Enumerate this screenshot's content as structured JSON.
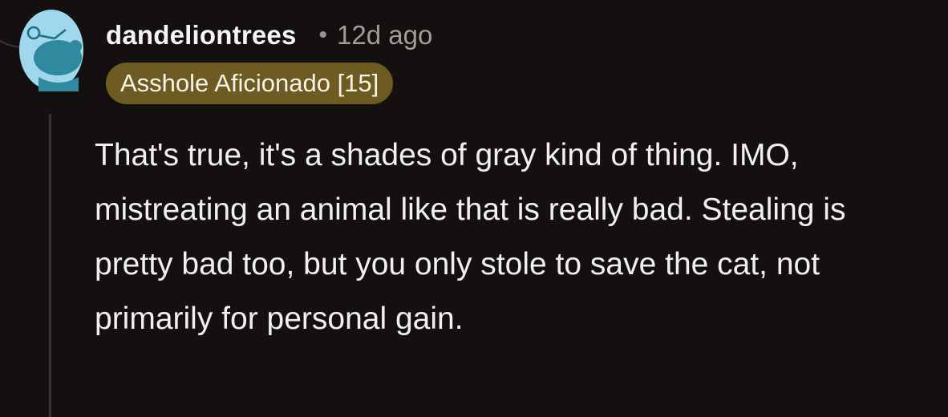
{
  "comment": {
    "author": "dandeliontrees",
    "separator": "•",
    "age": "12d ago",
    "flair": "Asshole Aficionado [15]",
    "colors": {
      "background": "#141010",
      "flair_background": "#6d5b22",
      "avatar_background": "#9fd8ec",
      "avatar_figure": "#2f8aa0"
    },
    "avatar_icon": "snoo-avatar-icon",
    "body": "That's true, it's a shades of gray kind of thing. IMO, mistreating an animal like that is really bad. Stealing is pretty bad too, but you only stole to save the cat, not primarily for personal gain."
  }
}
